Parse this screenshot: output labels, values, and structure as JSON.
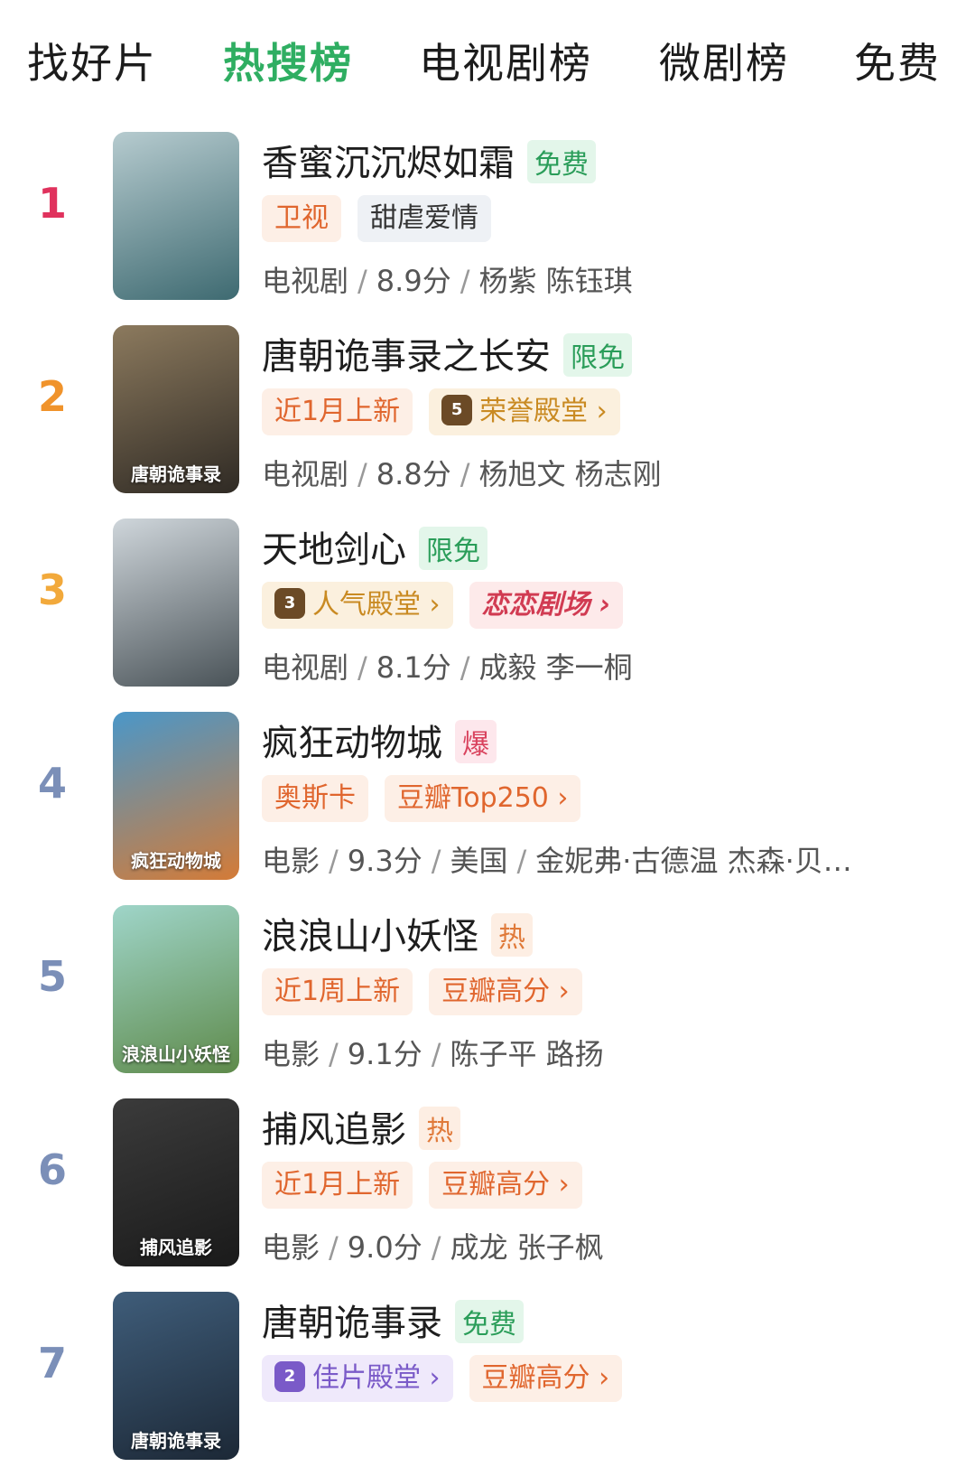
{
  "tabs": [
    {
      "label": "找好片",
      "active": false
    },
    {
      "label": "热搜榜",
      "active": true
    },
    {
      "label": "电视剧榜",
      "active": false
    },
    {
      "label": "微剧榜",
      "active": false
    },
    {
      "label": "免费",
      "active": false
    }
  ],
  "items": [
    {
      "rank": "1",
      "rank_color": "#e0325d",
      "title": "香蜜沉沉烬如霜",
      "badge": "免费",
      "badge_style": "green",
      "poster_colors": [
        "#b6cbcf",
        "#3e6a71"
      ],
      "poster_text": "",
      "tags": [
        {
          "label": "卫视",
          "style": "orange"
        },
        {
          "label": "甜虐爱情",
          "style": "gray"
        }
      ],
      "meta": [
        "电视剧",
        "8.9分",
        "杨紫 陈钰琪"
      ]
    },
    {
      "rank": "2",
      "rank_color": "#f0932b",
      "title": "唐朝诡事录之长安",
      "badge": "限免",
      "badge_style": "green",
      "poster_colors": [
        "#8c7a5e",
        "#2f2a24"
      ],
      "poster_text": "唐朝诡事录",
      "tags": [
        {
          "label": "近1月上新",
          "style": "orange"
        },
        {
          "label": "荣誉殿堂 ›",
          "style": "gold",
          "icon": "5"
        }
      ],
      "meta": [
        "电视剧",
        "8.8分",
        "杨旭文 杨志刚"
      ]
    },
    {
      "rank": "3",
      "rank_color": "#f2a93b",
      "title": "天地剑心",
      "badge": "限免",
      "badge_style": "green",
      "poster_colors": [
        "#cfd6db",
        "#4a5358"
      ],
      "poster_text": "",
      "tags": [
        {
          "label": "人气殿堂 ›",
          "style": "gold",
          "icon": "3"
        },
        {
          "label": "恋恋剧场 ›",
          "style": "pink"
        }
      ],
      "meta": [
        "电视剧",
        "8.1分",
        "成毅 李一桐"
      ]
    },
    {
      "rank": "4",
      "rank_color": "#7b8fb8",
      "title": "疯狂动物城",
      "badge": "爆",
      "badge_style": "red",
      "poster_colors": [
        "#4a97c9",
        "#d47b37"
      ],
      "poster_text": "疯狂动物城",
      "tags": [
        {
          "label": "奥斯卡",
          "style": "orange"
        },
        {
          "label": "豆瓣Top250 ›",
          "style": "orange"
        }
      ],
      "meta": [
        "电影",
        "9.3分",
        "美国",
        "金妮弗·古德温 杰森·贝…"
      ]
    },
    {
      "rank": "5",
      "rank_color": "#7b8fb8",
      "title": "浪浪山小妖怪",
      "badge": "热",
      "badge_style": "orange",
      "poster_colors": [
        "#9fd5c9",
        "#5e8a4a"
      ],
      "poster_text": "浪浪山小妖怪",
      "tags": [
        {
          "label": "近1周上新",
          "style": "orange"
        },
        {
          "label": "豆瓣高分 ›",
          "style": "orange"
        }
      ],
      "meta": [
        "电影",
        "9.1分",
        "陈子平 路扬"
      ]
    },
    {
      "rank": "6",
      "rank_color": "#7b8fb8",
      "title": "捕风追影",
      "badge": "热",
      "badge_style": "orange",
      "poster_colors": [
        "#3b3b3b",
        "#1a1a1a"
      ],
      "poster_text": "捕风追影",
      "tags": [
        {
          "label": "近1月上新",
          "style": "orange"
        },
        {
          "label": "豆瓣高分 ›",
          "style": "orange"
        }
      ],
      "meta": [
        "电影",
        "9.0分",
        "成龙 张子枫"
      ]
    },
    {
      "rank": "7",
      "rank_color": "#7b8fb8",
      "title": "唐朝诡事录",
      "badge": "免费",
      "badge_style": "green",
      "poster_colors": [
        "#3f5d7a",
        "#1c2836"
      ],
      "poster_text": "唐朝诡事录",
      "tags": [
        {
          "label": "佳片殿堂 ›",
          "style": "purple",
          "icon": "2"
        },
        {
          "label": "豆瓣高分 ›",
          "style": "orange"
        }
      ],
      "meta": []
    }
  ]
}
